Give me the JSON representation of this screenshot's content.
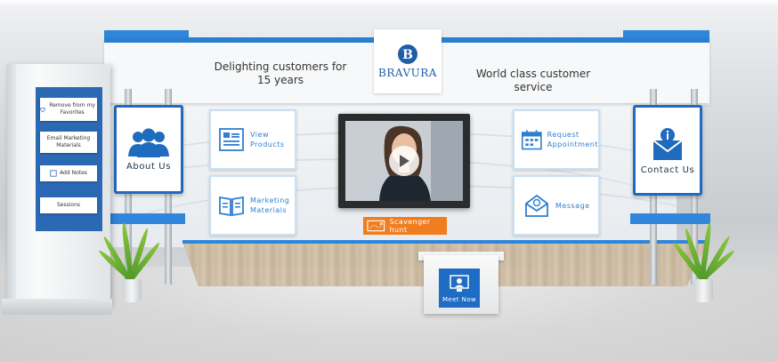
{
  "booth": {
    "tagline_left": "Delighting customers for 15 years",
    "tagline_right": "World class customer service",
    "brand": "BRAVURA"
  },
  "signs": {
    "about_us": "About Us",
    "contact_us": "Contact Us"
  },
  "panels": {
    "view_products": [
      "View",
      "Products"
    ],
    "marketing_materials": [
      "Marketing",
      "Materials"
    ],
    "request_appointment": [
      "Request",
      "Appointment"
    ],
    "message": "Message"
  },
  "kiosk": {
    "remove_favorites": "Remove from my Favorites",
    "email_marketing": "Email Marketing Materials",
    "add_notes": "Add Notes",
    "sessions": "Sessions"
  },
  "scavenger_hunt": "Scavenger hunt",
  "meet_now": "Meet Now",
  "colors": {
    "brand_blue": "#1f6cc4",
    "accent_orange": "#f07d1e",
    "panel_text": "#2f7fcf"
  }
}
